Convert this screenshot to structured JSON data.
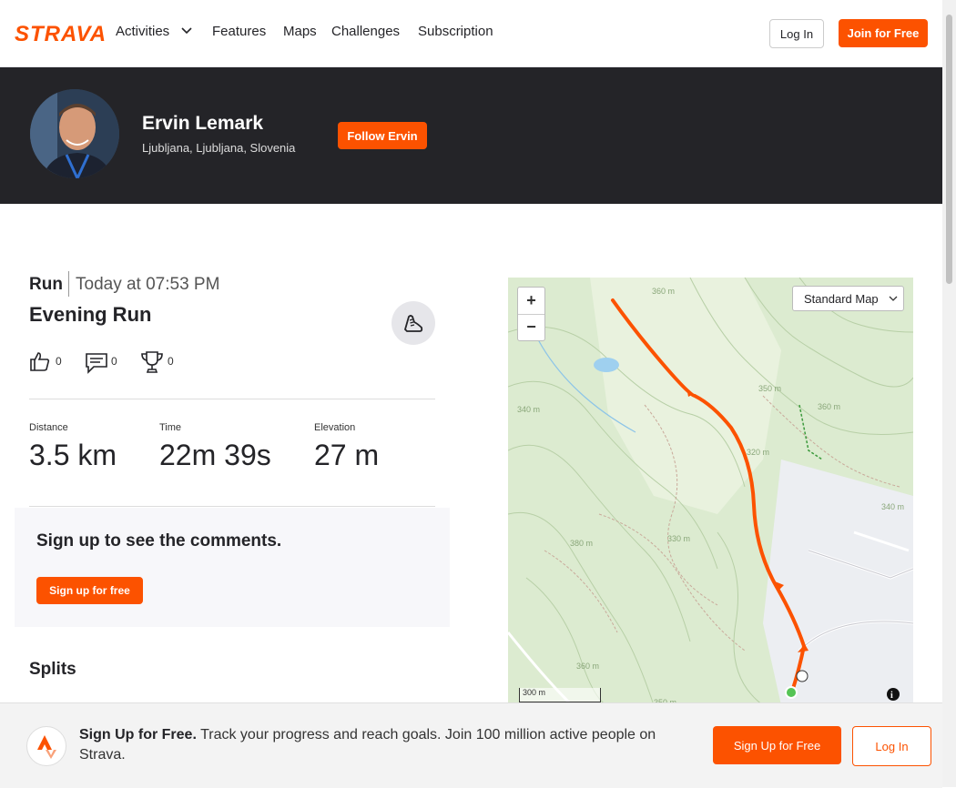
{
  "nav": {
    "logo": "STRAVA",
    "links": [
      "Activities",
      "Features",
      "Maps",
      "Challenges",
      "Subscription"
    ],
    "login_label": "Log In",
    "join_label": "Join for Free"
  },
  "athlete": {
    "name": "Ervin Lemark",
    "location": "Ljubljana, Ljubljana, Slovenia",
    "follow_label": "Follow Ervin"
  },
  "activity": {
    "type": "Run",
    "time": "Today at 07:53 PM",
    "name": "Evening Run",
    "kudos_count": "0",
    "comments_count": "0",
    "achievements_count": "0",
    "stats": [
      {
        "label": "Distance",
        "value": "3.5 km"
      },
      {
        "label": "Time",
        "value": "22m 39s"
      },
      {
        "label": "Elevation",
        "value": "27 m"
      }
    ]
  },
  "comments": {
    "title": "Sign up to see the comments.",
    "button": "Sign up for free"
  },
  "splits": {
    "title": "Splits"
  },
  "map": {
    "type_label": "Standard Map",
    "zoom_in": "+",
    "zoom_out": "−",
    "scale_label": "300 m",
    "contour_labels": [
      "360 m",
      "340 m",
      "350 m",
      "360 m",
      "320 m",
      "380 m",
      "330 m",
      "340 m",
      "360 m",
      "350 m"
    ]
  },
  "banner": {
    "bold": "Sign Up for Free.",
    "text": " Track your progress and reach goals. Join 100 million active people on Strava.",
    "signup_label": "Sign Up for Free",
    "login_label": "Log In"
  },
  "colors": {
    "brand": "#fc5200",
    "header_bg": "#242428",
    "map_bg": "#e3efd7"
  }
}
